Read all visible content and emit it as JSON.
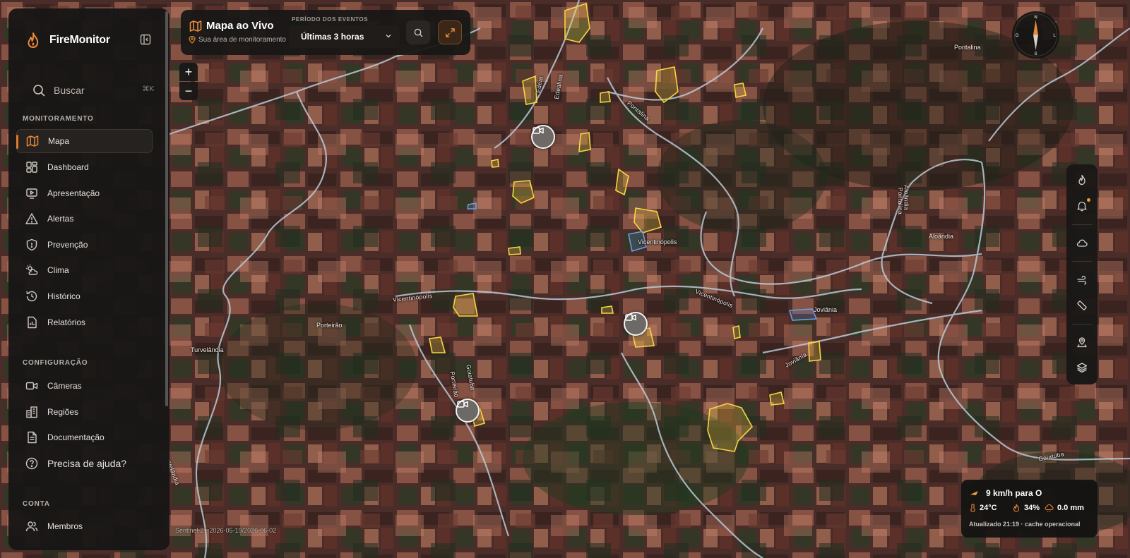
{
  "app": {
    "name": "FireMonitor"
  },
  "sidebar": {
    "search_label": "Buscar",
    "search_shortcut": "⌘K",
    "sections": [
      {
        "title": "MONITORAMENTO"
      },
      {
        "title": "CONFIGURAÇÃO"
      },
      {
        "title": "CONTA"
      }
    ],
    "monitor_items": [
      {
        "label": "Mapa",
        "icon": "map-icon",
        "active": true
      },
      {
        "label": "Dashboard",
        "icon": "dashboard-icon"
      },
      {
        "label": "Apresentação",
        "icon": "presentation-icon"
      },
      {
        "label": "Alertas",
        "icon": "alert-triangle-icon"
      },
      {
        "label": "Prevenção",
        "icon": "shield-icon"
      },
      {
        "label": "Clima",
        "icon": "weather-icon"
      },
      {
        "label": "Histórico",
        "icon": "history-icon"
      },
      {
        "label": "Relatórios",
        "icon": "report-icon"
      }
    ],
    "config_items": [
      {
        "label": "Câmeras",
        "icon": "camera-icon"
      },
      {
        "label": "Regiões",
        "icon": "regions-icon"
      },
      {
        "label": "Documentação",
        "icon": "document-icon"
      }
    ],
    "help_label": "Precisa de ajuda?",
    "account_items": [
      {
        "label": "Membros",
        "icon": "users-icon"
      }
    ]
  },
  "topbar": {
    "title": "Mapa ao Vivo",
    "subtitle": "Sua área de monitoramento",
    "period_label": "PERÍODO DOS EVENTOS",
    "period_value": "Últimas 3 horas"
  },
  "zoom": {
    "in": "+",
    "out": "−"
  },
  "compass": {
    "n": "N",
    "s": "S",
    "e": "L",
    "w": "O"
  },
  "map_labels": {
    "pontalina_city": "Pontalina",
    "vicentinopolis_city": "Vicentinópolis",
    "aloandia_city": "Aloândia",
    "joviania_city": "Joviânia",
    "porteirao_city": "Porteirão",
    "turvelandia_city": "Turvelândia",
    "road_edeia": "Edéia",
    "road_edealina": "Edealina",
    "road_pontalina": "Pontalina",
    "road_aloandia": "Aloândia",
    "road_pontalina2": "Pontalina",
    "road_vicentinopolis_w": "Vicentinópolis",
    "road_vicentinopolis_e": "Vicentinópolis",
    "road_joviania": "Joviânia",
    "road_goiatuba": "Goiatuba",
    "road_porteirao": "Porteirão",
    "road_goiatuba_e": "Goiatuba",
    "road_turvelandia": "Turvelândia"
  },
  "attribution": "Sentinel-2 · 2026-05-19/2026-06-02",
  "weather": {
    "wind": "9 km/h para O",
    "temperature": "24°C",
    "humidity": "34%",
    "rain": "0.0 mm",
    "updated": "Atualizado 21:19 · cache operacional"
  },
  "colors": {
    "accent": "#e07a2e",
    "burn_area": "#f5d742",
    "water_area": "#5b8fd9",
    "road": "#d4dde6"
  }
}
